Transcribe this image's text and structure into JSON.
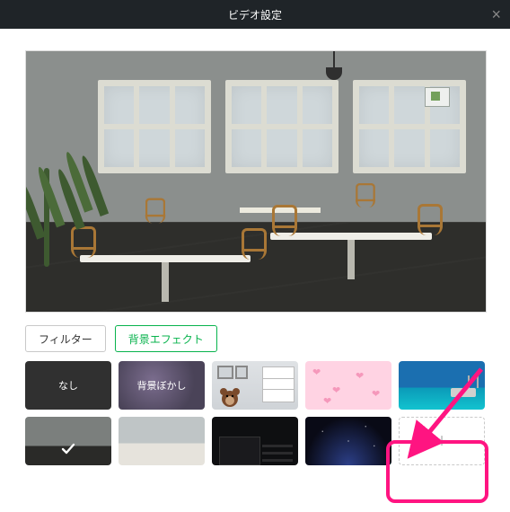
{
  "header": {
    "title": "ビデオ設定"
  },
  "tabs": {
    "filter": "フィルター",
    "bgEffect": "背景エフェクト"
  },
  "thumbs": {
    "none": "なし",
    "blur": "背景ぼかし",
    "add": "+"
  },
  "icons": {
    "close": "close-icon",
    "check": "check-icon",
    "plus": "plus-icon"
  }
}
